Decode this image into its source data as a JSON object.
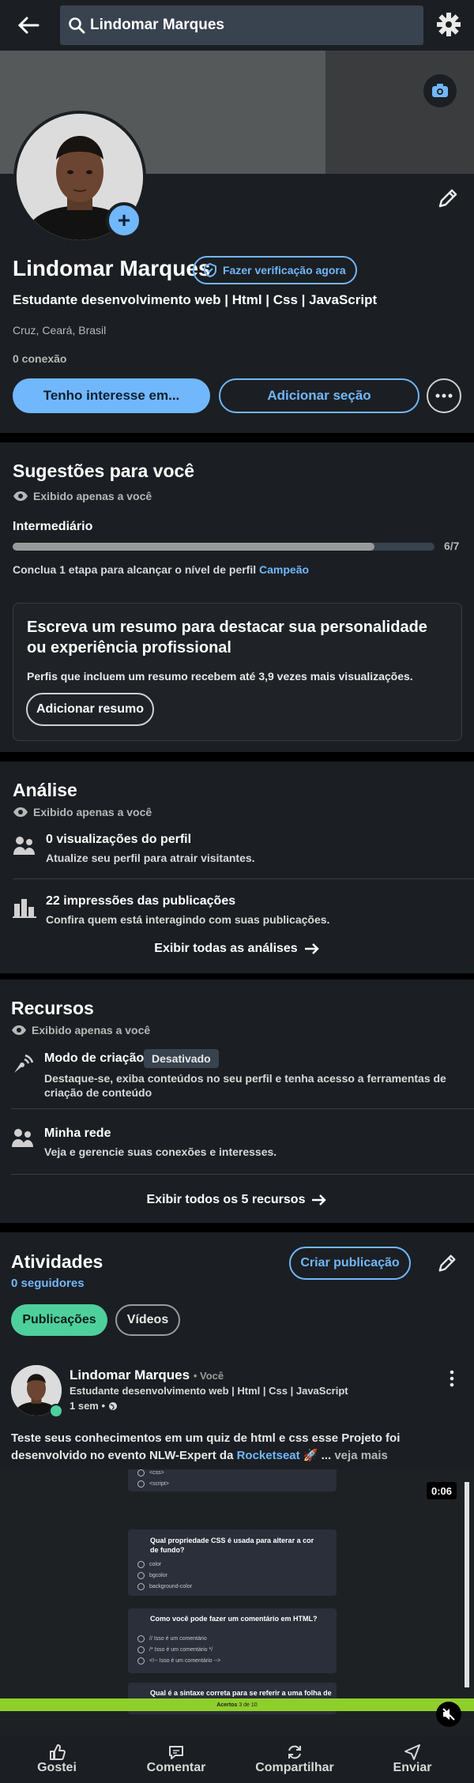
{
  "search": {
    "query": "Lindomar Marques"
  },
  "profile": {
    "name": "Lindomar Marques",
    "verify_label": "Fazer verificação agora",
    "headline": "Estudante desenvolvimento web | Html | Css | JavaScript",
    "location": "Cruz, Ceará, Brasil",
    "connections": "0 conexão",
    "btn_interest": "Tenho interesse em...",
    "btn_add_section": "Adicionar seção"
  },
  "suggestions": {
    "title": "Sugestões para você",
    "private": "Exibido apenas a você",
    "level": "Intermediário",
    "progress_value": 6,
    "progress_max": 7,
    "progress_label": "6/7",
    "hint_prefix": "Conclua 1 etapa para alcançar o nível de perfil",
    "hint_link": "Campeão",
    "box_title": "Escreva um resumo para destacar sua personalidade ou experiência profissional",
    "box_text": "Perfis que incluem um resumo recebem até 3,9 vezes mais visualizações.",
    "box_button": "Adicionar resumo"
  },
  "analytics": {
    "title": "Análise",
    "private": "Exibido apenas a você",
    "items": [
      {
        "title": "0 visualizações do perfil",
        "sub": "Atualize seu perfil para atrair visitantes.",
        "icon": "people-icon"
      },
      {
        "title": "22 impressões das publicações",
        "sub": "Confira quem está interagindo com suas publicações.",
        "icon": "bar-chart-icon"
      }
    ],
    "show_all": "Exibir todas as análises"
  },
  "resources": {
    "title": "Recursos",
    "private": "Exibido apenas a você",
    "creator_title": "Modo de criação",
    "creator_badge": "Desativado",
    "creator_sub": "Destaque-se, exiba conteúdos no seu perfil e tenha acesso a ferramentas de criação de conteúdo",
    "network_title": "Minha rede",
    "network_sub": "Veja e gerencie suas conexões e interesses.",
    "show_all": "Exibir todos os 5 recursos"
  },
  "activity": {
    "title": "Atividades",
    "followers": "0 seguidores",
    "create_post": "Criar publicação",
    "tabs": [
      "Publicações",
      "Vídeos"
    ],
    "post": {
      "author": "Lindomar Marques",
      "author_suffix": "• Você",
      "headline": "Estudante desenvolvimento web | Html | Css | JavaScript",
      "time": "1 sem •",
      "text_prefix": "Teste seus conhecimentos em um quiz de html e css esse Projeto foi desenvolvido no evento NLW-Expert da",
      "text_link": "Rocketseat",
      "text_suffix": "🚀 ...",
      "see_more": "veja mais"
    }
  },
  "video": {
    "duration": "0:06",
    "top_opts": [
      "<css>",
      "<script>"
    ],
    "q1": "Qual propriedade CSS é usada para alterar a cor de fundo?",
    "q1_opts": [
      "color",
      "bgcolor",
      "background-color"
    ],
    "q2": "Como você pode fazer um comentário em HTML?",
    "q2_opts": [
      "// Isso é um comentário",
      "/* Isso é um comentário */",
      "<!-- Isso é um comentário -->"
    ],
    "q3": "Qual é a sintaxe correta para se referir a uma folha de",
    "score_label": "Acertos",
    "score_value": "3 de 10"
  },
  "bottom_bar": [
    "Gostei",
    "Comentar",
    "Compartilhar",
    "Enviar"
  ],
  "colors": {
    "accent": "#71b7fb",
    "card": "#1b1f23",
    "green": "#4ed09c"
  }
}
